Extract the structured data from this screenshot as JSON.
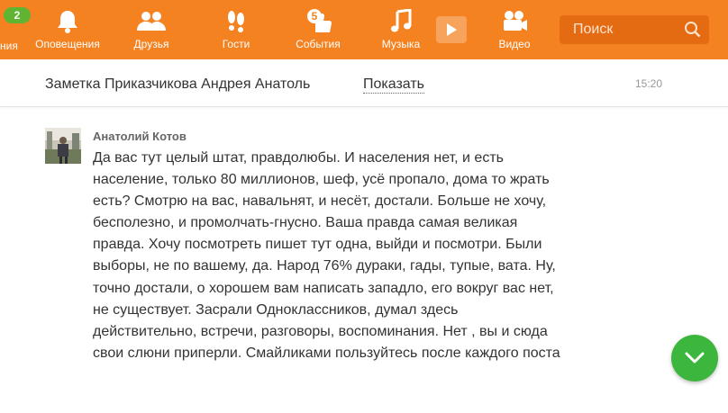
{
  "nav": {
    "badge": "2",
    "cut_label": "ния",
    "items": [
      {
        "label": "Оповещения",
        "icon": "bell-icon"
      },
      {
        "label": "Друзья",
        "icon": "friends-icon"
      },
      {
        "label": "Гости",
        "icon": "footprints-icon"
      },
      {
        "label": "События",
        "icon": "like-events-icon",
        "badge": "5"
      },
      {
        "label": "Музыка",
        "icon": "music-note-icon"
      },
      {
        "label": "Видео",
        "icon": "video-camera-icon"
      }
    ],
    "search_placeholder": "Поиск"
  },
  "subbar": {
    "title": "Заметка Приказчикова Андрея Анатоль",
    "show_link": "Показать",
    "time": "15:20"
  },
  "comment": {
    "author": "Анатолий Котов",
    "text": "Да вас тут целый штат, правдолюбы. И населения нет, и есть население, только 80 миллионов, шеф, усё пропало, дома то жрать есть? Смотрю на вас, навальнят, и несёт, достали. Больше не хочу, бесполезно, и промолчать-гнусно. Ваша правда самая великая правда. Хочу посмотреть пишет тут одна, выйди и посмотри. Были выборы, не по вашему, да. Народ 76% дураки, гады, тупые, вата. Ну, точно достали, о хорошем вам написать западло, его вокруг вас нет, не существует. Засрали Одноклассников, думал здесь действительно, встречи, разговоры, воспоминания. Нет , вы и сюда свои слюни приперли. Смайликами пользуйтесь после каждого поста"
  },
  "colors": {
    "brand": "#f58220",
    "accent_green": "#3cb63c"
  }
}
